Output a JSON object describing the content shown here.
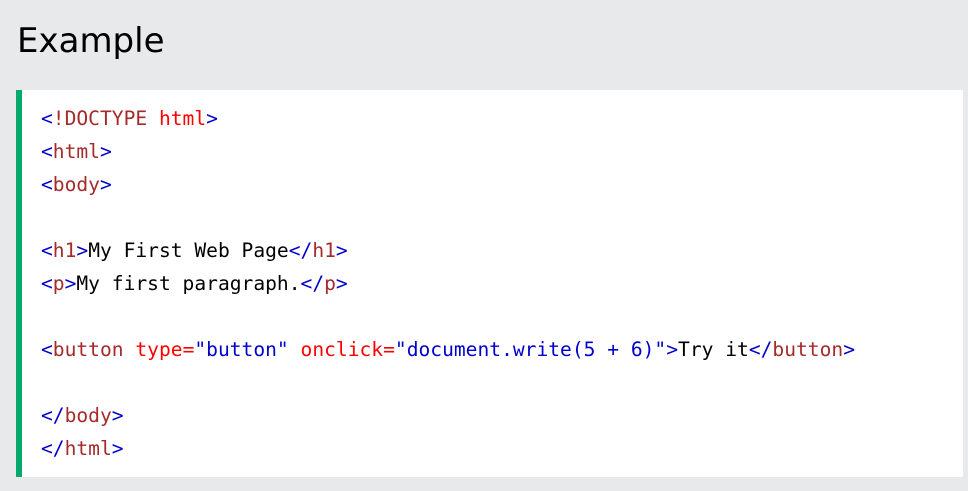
{
  "heading": "Example",
  "colors": {
    "page_background": "#e7e9eb",
    "code_background": "#ffffff",
    "accent_border": "#04aa6d",
    "bracket": "mediumblue",
    "tag": "brown",
    "attribute": "red",
    "attribute_value": "mediumblue",
    "text": "#000000"
  },
  "code_lines": [
    [
      {
        "text": "<",
        "type": "bracket"
      },
      {
        "text": "!DOCTYPE",
        "type": "tag"
      },
      {
        "text": " html",
        "type": "attr"
      },
      {
        "text": ">",
        "type": "bracket"
      }
    ],
    [
      {
        "text": "<",
        "type": "bracket"
      },
      {
        "text": "html",
        "type": "tag"
      },
      {
        "text": ">",
        "type": "bracket"
      }
    ],
    [
      {
        "text": "<",
        "type": "bracket"
      },
      {
        "text": "body",
        "type": "tag"
      },
      {
        "text": ">",
        "type": "bracket"
      }
    ],
    [],
    [
      {
        "text": "<",
        "type": "bracket"
      },
      {
        "text": "h1",
        "type": "tag"
      },
      {
        "text": ">",
        "type": "bracket"
      },
      {
        "text": "My First Web Page",
        "type": "text"
      },
      {
        "text": "</",
        "type": "bracket"
      },
      {
        "text": "h1",
        "type": "tag"
      },
      {
        "text": ">",
        "type": "bracket"
      }
    ],
    [
      {
        "text": "<",
        "type": "bracket"
      },
      {
        "text": "p",
        "type": "tag"
      },
      {
        "text": ">",
        "type": "bracket"
      },
      {
        "text": "My first paragraph.",
        "type": "text"
      },
      {
        "text": "</",
        "type": "bracket"
      },
      {
        "text": "p",
        "type": "tag"
      },
      {
        "text": ">",
        "type": "bracket"
      }
    ],
    [],
    [
      {
        "text": "<",
        "type": "bracket"
      },
      {
        "text": "button",
        "type": "tag"
      },
      {
        "text": " type",
        "type": "attr"
      },
      {
        "text": "=",
        "type": "attr"
      },
      {
        "text": "\"button\"",
        "type": "value"
      },
      {
        "text": " onclick",
        "type": "attr"
      },
      {
        "text": "=",
        "type": "attr"
      },
      {
        "text": "\"document.write(5 + 6)\"",
        "type": "value"
      },
      {
        "text": ">",
        "type": "bracket"
      },
      {
        "text": "Try it",
        "type": "text"
      },
      {
        "text": "</",
        "type": "bracket"
      },
      {
        "text": "button",
        "type": "tag"
      },
      {
        "text": ">",
        "type": "bracket"
      }
    ],
    [],
    [
      {
        "text": "</",
        "type": "bracket"
      },
      {
        "text": "body",
        "type": "tag"
      },
      {
        "text": ">",
        "type": "bracket"
      }
    ],
    [
      {
        "text": "</",
        "type": "bracket"
      },
      {
        "text": "html",
        "type": "tag"
      },
      {
        "text": ">",
        "type": "bracket"
      }
    ]
  ]
}
